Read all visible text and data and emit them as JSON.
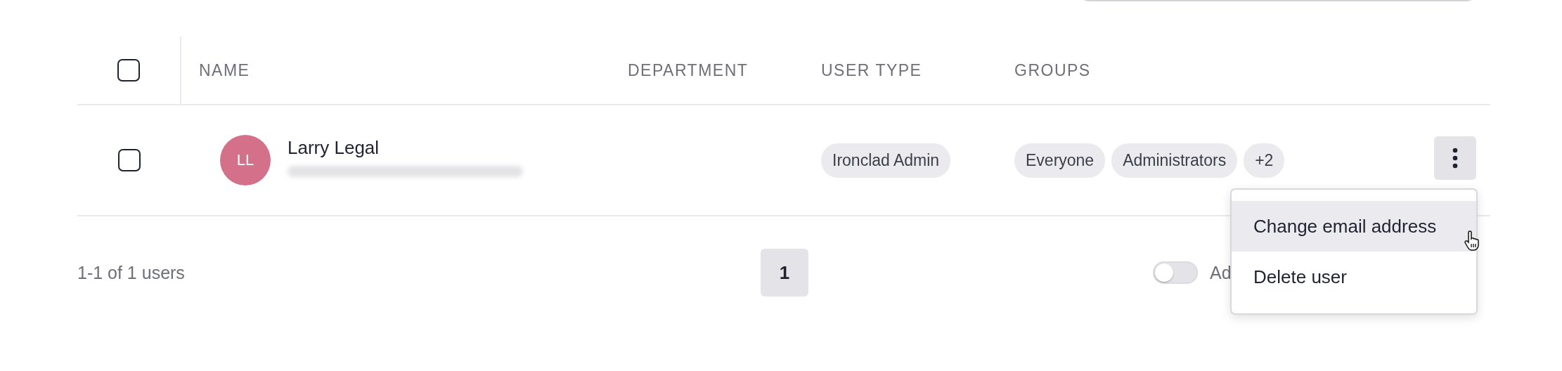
{
  "table": {
    "columns": [
      "NAME",
      "DEPARTMENT",
      "USER TYPE",
      "GROUPS"
    ],
    "header_checkbox": {
      "checked": false
    },
    "rows": [
      {
        "checked": false,
        "initials": "LL",
        "color": "#d4708a",
        "name": "Larry Legal",
        "user_type": "Ironclad Admin",
        "groups": [
          "Everyone",
          "Administrators",
          "+2"
        ]
      }
    ]
  },
  "footer": {
    "count": "1-1 of 1 users",
    "pages": [
      {
        "label": "1",
        "selected": true
      }
    ],
    "toggle": {
      "on": false,
      "label": "Ad"
    }
  },
  "menu": {
    "items": [
      {
        "label": "Change email address",
        "selected": true
      },
      {
        "label": "Delete user",
        "selected": false
      }
    ]
  }
}
